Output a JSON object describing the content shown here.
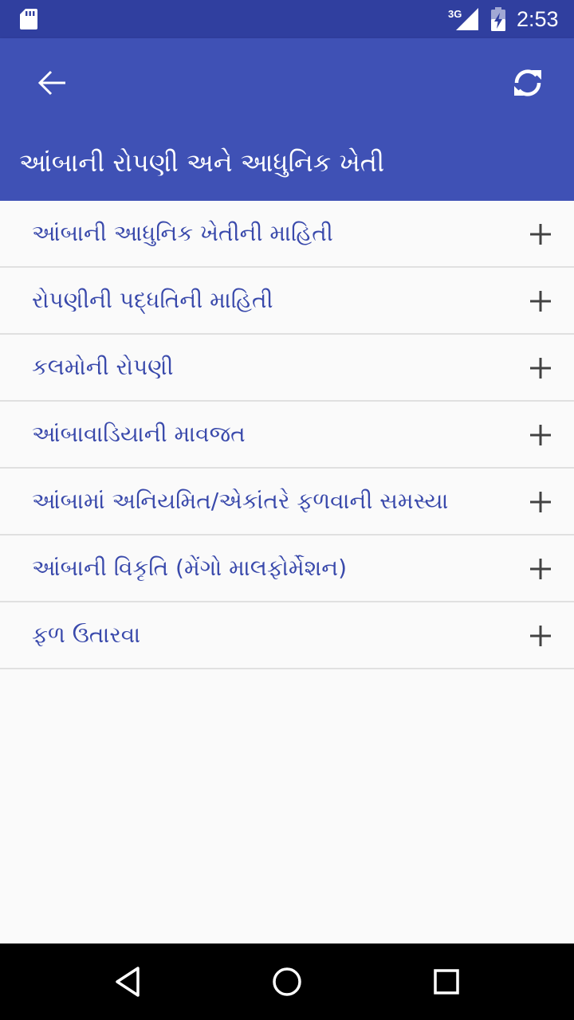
{
  "status_bar": {
    "time": "2:53",
    "network_label": "3G",
    "icons": [
      "sd-card-icon",
      "signal-icon",
      "battery-icon"
    ]
  },
  "app_bar": {
    "title": "આંબાની રોપણી અને આધુનિક ખેતી",
    "back_icon": "arrow-left-icon",
    "refresh_icon": "refresh-icon",
    "background_color": "#3f51b5",
    "status_color": "#303f9f"
  },
  "list": {
    "expand_icon": "plus-icon",
    "text_color": "#3949ab",
    "items": [
      {
        "label": "આંબાની આધુનિક ખેતીની માહિતી"
      },
      {
        "label": "રોપણીની પદ્ધતિની માહિતી"
      },
      {
        "label": "કલમોની રોપણી"
      },
      {
        "label": "આંબાવાડિયાની માવજત"
      },
      {
        "label": "આંબામાં અનિયમિત/એકાંતરે ફળવાની સમસ્યા"
      },
      {
        "label": "આંબાની વિકૃતિ (મેંગો માલફોર્મેશન)"
      },
      {
        "label": "ફળ ઉતારવા"
      }
    ]
  },
  "nav_bar": {
    "icons": [
      "nav-back-icon",
      "nav-home-icon",
      "nav-recents-icon"
    ]
  }
}
